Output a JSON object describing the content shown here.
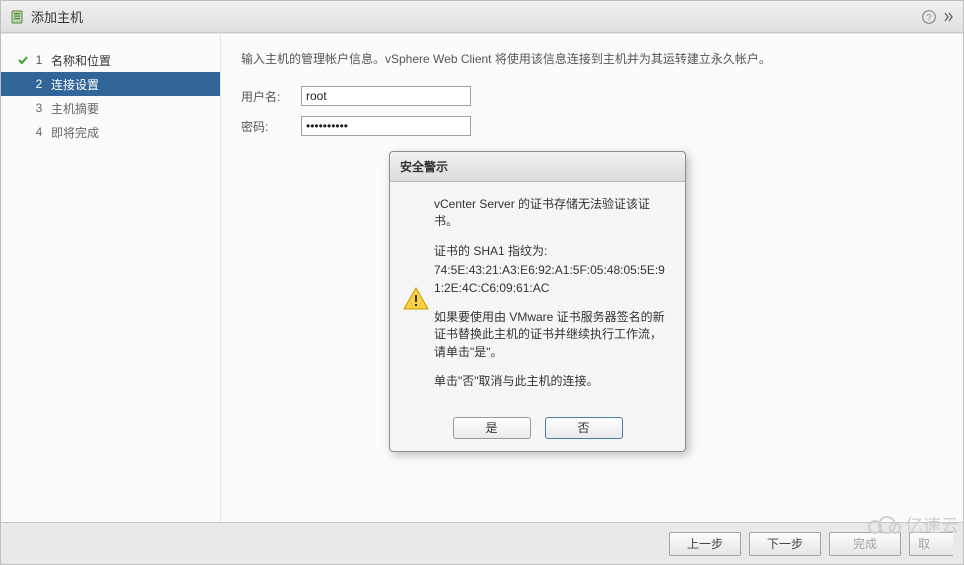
{
  "header": {
    "title": "添加主机"
  },
  "nav": {
    "items": [
      {
        "num": "1",
        "label": "名称和位置"
      },
      {
        "num": "2",
        "label": "连接设置"
      },
      {
        "num": "3",
        "label": "主机摘要"
      },
      {
        "num": "4",
        "label": "即将完成"
      }
    ]
  },
  "main": {
    "instruction": "输入主机的管理帐户信息。vSphere Web Client 将使用该信息连接到主机并为其运转建立永久帐户。",
    "user_label": "用户名:",
    "user_value": "root",
    "pass_label": "密码:",
    "pass_value": "**********"
  },
  "dialog": {
    "title": "安全警示",
    "line1": "vCenter Server 的证书存储无法验证该证书。",
    "line2": "证书的 SHA1 指纹为:",
    "fingerprint": "74:5E:43:21:A3:E6:92:A1:5F:05:48:05:5E:91:2E:4C:C6:09:61:AC",
    "line3": "如果要使用由 VMware 证书服务器签名的新证书替换此主机的证书并继续执行工作流，请单击\"是\"。",
    "line4": "单击\"否\"取消与此主机的连接。",
    "yes": "是",
    "no": "否"
  },
  "footer": {
    "back": "上一步",
    "next": "下一步",
    "finish": "完成",
    "cancel": "取"
  },
  "watermark": "亿速云"
}
